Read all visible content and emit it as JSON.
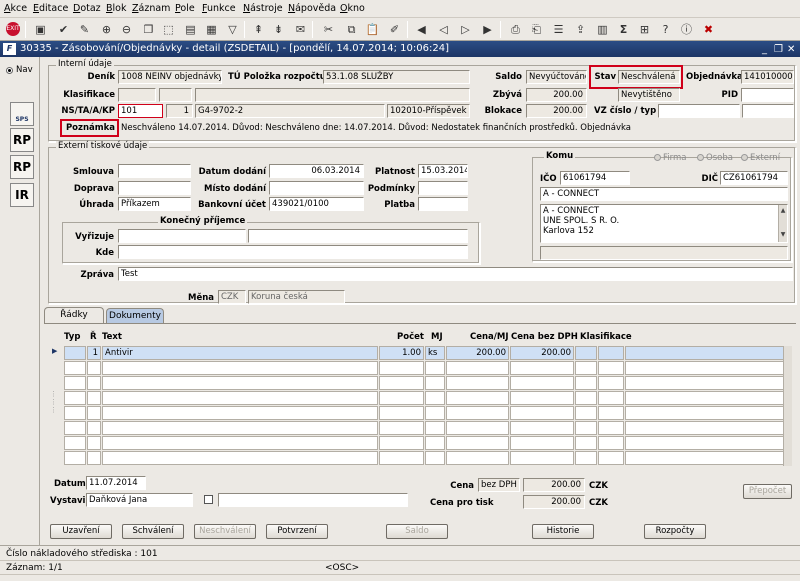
{
  "menu": [
    "Akce",
    "Editace",
    "Dotaz",
    "Blok",
    "Záznam",
    "Pole",
    "Funkce",
    "Nástroje",
    "Nápověda",
    "Okno"
  ],
  "window": {
    "title": "30335 - Zásobování/Objednávky - detail (ZSDETAIL) - [pondělí, 14.07.2014; 10:06:24]"
  },
  "nav": {
    "radio_label": "Nav",
    "icons": [
      "SPS",
      "RP",
      "RP",
      "IR"
    ]
  },
  "internal": {
    "title": "Interní údaje",
    "labels": {
      "denik": "Deník",
      "tu": "TÚ Položka rozpočtu",
      "saldo": "Saldo",
      "stav": "Stav",
      "objednavka": "Objednávka",
      "klasifikace": "Klasifikace",
      "zbyva": "Zbývá",
      "pid": "PID",
      "ns": "NS/TA/A/KP",
      "blokace": "Blokace",
      "vz": "VZ číslo / typ",
      "poznamka": "Poznámka"
    },
    "values": {
      "denik": "1008 NEINV objednávky",
      "tu": "53.1.08 SLUŽBY",
      "saldo": "Nevyúčtováno",
      "stav": "Neschválená",
      "objednavka": "1410100005",
      "zbyva": "200.00",
      "nevytisteno": "Nevytištěno",
      "ns": "101",
      "ta": "1",
      "a": "G4-9702-2",
      "kp": "102010-Příspěvek",
      "blokace": "200.00",
      "poznamka": "Neschváleno 14.07.2014. Důvod: Neschváleno dne: 14.07.2014. Důvod: Nedostatek finančních prostředků. Objednávka"
    }
  },
  "external": {
    "title": "Externí tiskové údaje",
    "labels": {
      "smlouva": "Smlouva",
      "datum_dodani": "Datum dodání",
      "platnost": "Platnost",
      "doprava": "Doprava",
      "misto_dodani": "Místo dodání",
      "podminky": "Podmínky",
      "uhrada": "Úhrada",
      "bankovni_ucet": "Bankovní účet",
      "platba": "Platba",
      "konecny": "Konečný příjemce",
      "vyrizuje": "Vyřizuje",
      "kde": "Kde",
      "zprava": "Zpráva",
      "mena": "Měna"
    },
    "values": {
      "datum_dodani": "06.03.2014",
      "platnost": "15.03.2014",
      "uhrada": "Příkazem",
      "bankovni_ucet": "439021/0100",
      "zprava": "Test",
      "mena_code": "CZK",
      "mena_name": "Koruna česká"
    }
  },
  "komu": {
    "title": "Komu",
    "radios": [
      "Firma",
      "Osoba",
      "Externí"
    ],
    "ico_label": "IČO",
    "ico": "61061794",
    "dic_label": "DIČ",
    "dic": "CZ61061794",
    "name": "A - CONNECT",
    "address": [
      "A - CONNECT",
      "UNE SPOL. S R. O.",
      "Karlova 152"
    ]
  },
  "tabs": [
    "Řádky",
    "Dokumenty"
  ],
  "grid": {
    "headers": [
      "Typ",
      "Ř",
      "Text",
      "Počet",
      "MJ",
      "Cena/MJ",
      "Cena bez DPH",
      "Klasifikace"
    ],
    "rows": [
      {
        "r": "1",
        "text": "Antivir",
        "pocet": "1.00",
        "mj": "ks",
        "cena_mj": "200.00",
        "cena_bez": "200.00"
      }
    ]
  },
  "footer": {
    "datum_label": "Datum",
    "datum": "11.07.2014",
    "vystavil_label": "Vystavil",
    "vystavil": "Daňková Jana",
    "cena_label": "Cena",
    "cena_typ": "bez DPH",
    "cena": "200.00",
    "cena_mena": "CZK",
    "cena_tisk_label": "Cena pro tisk",
    "cena_tisk": "200.00",
    "cena_tisk_mena": "CZK",
    "prepocet": "Přepočet"
  },
  "buttons": [
    "Uzavření",
    "Schválení",
    "Neschválení",
    "Potvrzení",
    "Saldo",
    "Historie",
    "Rozpočty"
  ],
  "status": {
    "line1": "Číslo nákladového střediska : 101",
    "line2": "Záznam: 1/1",
    "line2_mid": "<OSC>"
  },
  "colors": {
    "title_bar": "#1d3565",
    "highlight": "#d0001a",
    "selected_row": "#cfe0f5"
  }
}
